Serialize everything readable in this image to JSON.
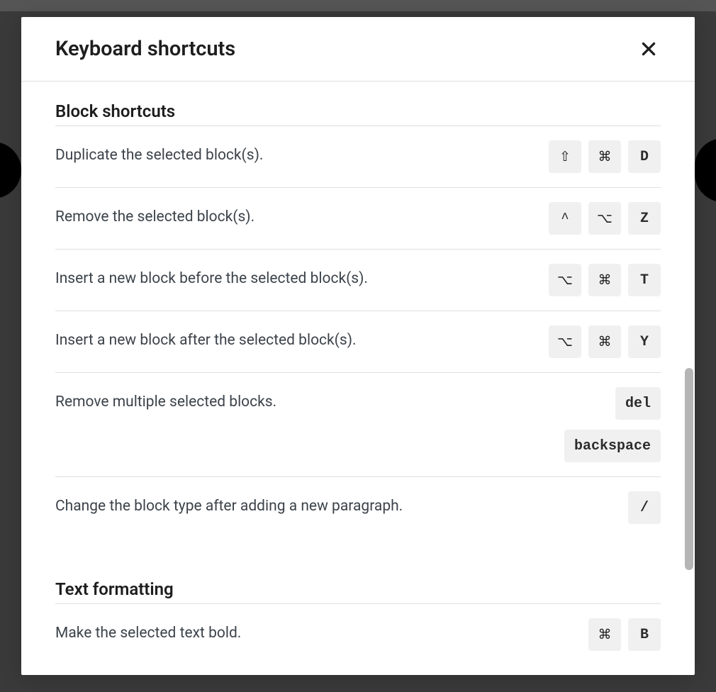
{
  "modal": {
    "title": "Keyboard shortcuts"
  },
  "sections": [
    {
      "title": "Block shortcuts",
      "rows": [
        {
          "desc": "Duplicate the selected block(s).",
          "combos": [
            [
              "⇧",
              "⌘",
              "D"
            ]
          ]
        },
        {
          "desc": "Remove the selected block(s).",
          "combos": [
            [
              "^",
              "⌥",
              "Z"
            ]
          ]
        },
        {
          "desc": "Insert a new block before the selected block(s).",
          "combos": [
            [
              "⌥",
              "⌘",
              "T"
            ]
          ]
        },
        {
          "desc": "Insert a new block after the selected block(s).",
          "combos": [
            [
              "⌥",
              "⌘",
              "Y"
            ]
          ]
        },
        {
          "desc": "Remove multiple selected blocks.",
          "combos": [
            [
              "del"
            ],
            [
              "backspace"
            ]
          ]
        },
        {
          "desc": "Change the block type after adding a new paragraph.",
          "combos": [
            [
              "/"
            ]
          ]
        }
      ]
    },
    {
      "title": "Text formatting",
      "rows": [
        {
          "desc": "Make the selected text bold.",
          "combos": [
            [
              "⌘",
              "B"
            ]
          ]
        }
      ]
    }
  ]
}
